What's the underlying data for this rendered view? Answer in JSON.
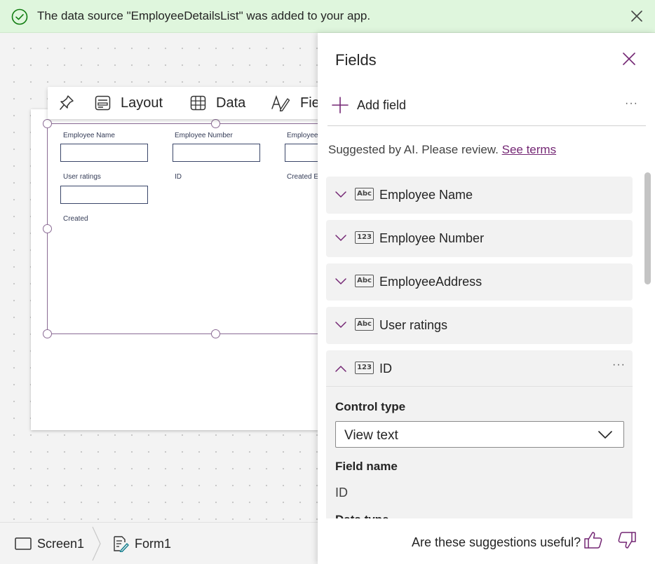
{
  "notification": {
    "message": "The data source \"EmployeeDetailsList\" was added to your app.",
    "icon": "checkmark-circle-icon",
    "color": "#dff6dd"
  },
  "toolbar": {
    "items": [
      {
        "icon": "pin-icon",
        "label": ""
      },
      {
        "icon": "layout-icon",
        "label": "Layout"
      },
      {
        "icon": "table-icon",
        "label": "Data"
      },
      {
        "icon": "fields-icon",
        "label": "Fie"
      }
    ]
  },
  "form": {
    "fields": [
      {
        "label": "Employee Name",
        "has_input": true
      },
      {
        "label": "Employee Number",
        "has_input": true
      },
      {
        "label": "Employee",
        "has_input": true
      },
      {
        "label": "User ratings",
        "has_input": true
      },
      {
        "label": "ID",
        "has_input": false
      },
      {
        "label": "Created E",
        "has_input": false
      },
      {
        "label": "Created",
        "has_input": false
      }
    ]
  },
  "bottom_bar": {
    "screen_label": "Screen1",
    "form_label": "Form1"
  },
  "panel": {
    "title": "Fields",
    "add_field_label": "Add field",
    "more_label": "···",
    "ai_note": "Suggested by AI. Please review.",
    "ai_link": "See terms",
    "fields": [
      {
        "type": "Abc",
        "name": "Employee Name",
        "expanded": false
      },
      {
        "type": "123",
        "name": "Employee Number",
        "expanded": false
      },
      {
        "type": "Abc",
        "name": "EmployeeAddress",
        "expanded": false
      },
      {
        "type": "Abc",
        "name": "User ratings",
        "expanded": false
      }
    ],
    "expanded_field": {
      "type": "123",
      "name": "ID",
      "more_label": "···",
      "control_type_label": "Control type",
      "control_type_value": "View text",
      "field_name_label": "Field name",
      "field_name_value": "ID",
      "next_label": "Data type"
    },
    "feedback": {
      "question": "Are these suggestions useful?",
      "like_icon": "thumbs-up-icon",
      "dislike_icon": "thumbs-down-icon"
    },
    "accent": "#742774"
  }
}
